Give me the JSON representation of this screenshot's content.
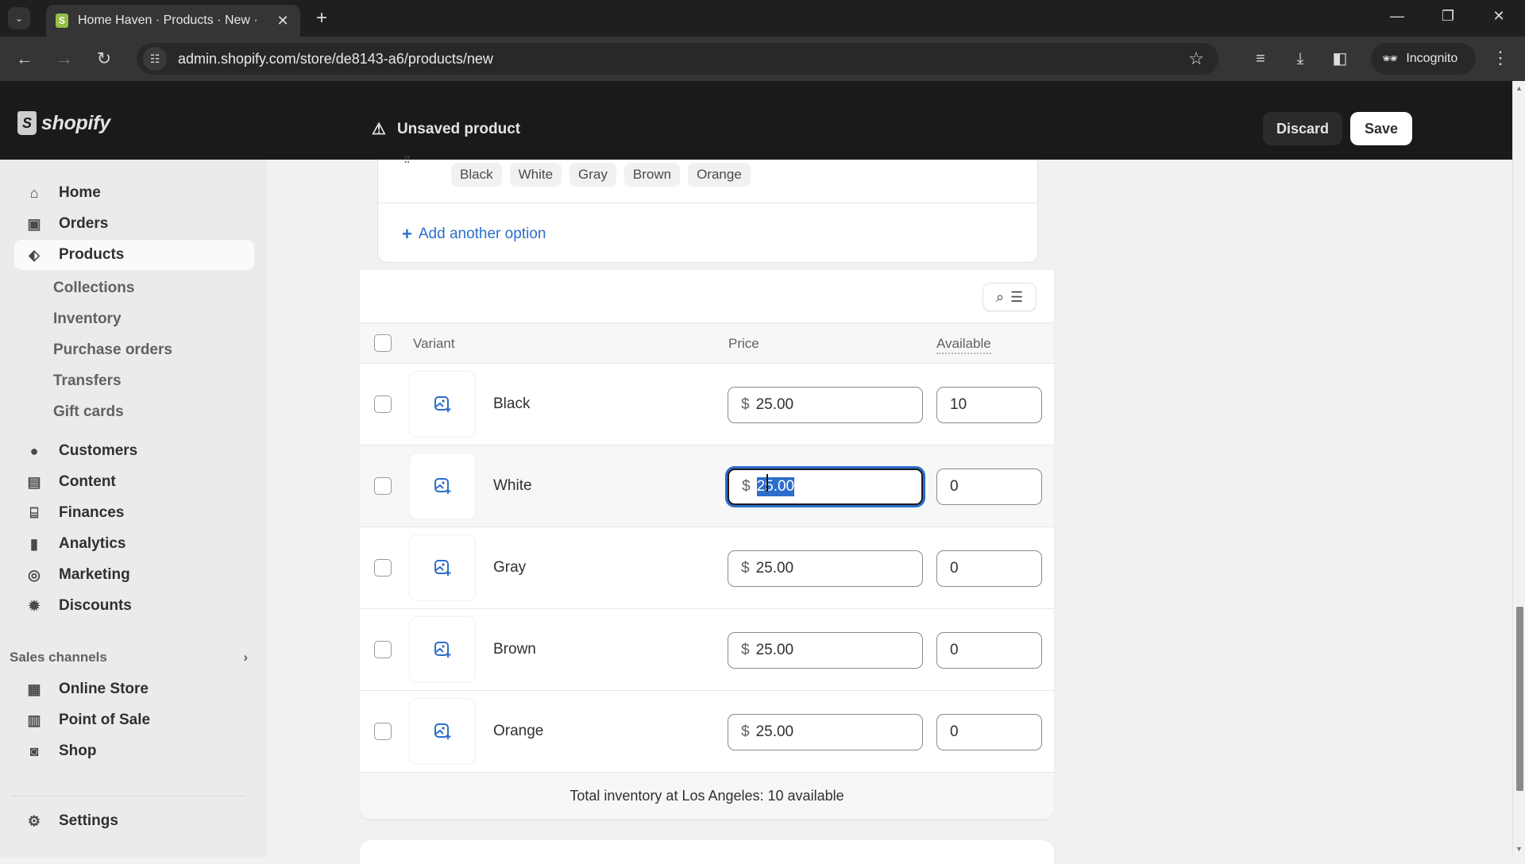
{
  "browser": {
    "tab_title": "Home Haven · Products · New ·",
    "favicon_label": "S",
    "url": "admin.shopify.com/store/de8143-a6/products/new",
    "incognito_label": "Incognito",
    "icons": {
      "tab_search": "chevron-down-icon",
      "new_tab": "plus-icon",
      "back": "arrow-left-icon",
      "forward": "arrow-right-icon",
      "reload": "reload-icon",
      "site_info": "tune-icon",
      "bookmark": "star-icon",
      "media": "playlist-icon",
      "downloads": "download-icon",
      "side_panel": "sidebar-icon",
      "menu": "kebab-icon"
    }
  },
  "header": {
    "logo_text": "shopify",
    "status_text": "Unsaved product",
    "discard_label": "Discard",
    "save_label": "Save"
  },
  "sidebar": {
    "items": [
      {
        "label": "Home",
        "icon": "home-icon"
      },
      {
        "label": "Orders",
        "icon": "inbox-icon"
      },
      {
        "label": "Products",
        "icon": "tag-icon",
        "active": true
      }
    ],
    "product_subitems": [
      "Collections",
      "Inventory",
      "Purchase orders",
      "Transfers",
      "Gift cards"
    ],
    "items2": [
      {
        "label": "Customers",
        "icon": "person-icon"
      },
      {
        "label": "Content",
        "icon": "content-icon"
      },
      {
        "label": "Finances",
        "icon": "bank-icon"
      },
      {
        "label": "Analytics",
        "icon": "bar-chart-icon"
      },
      {
        "label": "Marketing",
        "icon": "target-icon"
      },
      {
        "label": "Discounts",
        "icon": "discount-icon"
      }
    ],
    "sales_channels_label": "Sales channels",
    "channels": [
      {
        "label": "Online Store",
        "icon": "store-icon"
      },
      {
        "label": "Point of Sale",
        "icon": "pos-icon"
      },
      {
        "label": "Shop",
        "icon": "shop-icon"
      }
    ],
    "settings_label": "Settings"
  },
  "options": {
    "values": [
      "Black",
      "White",
      "Gray",
      "Brown",
      "Orange"
    ],
    "add_option_label": "Add another option"
  },
  "variants": {
    "columns": {
      "variant": "Variant",
      "price": "Price",
      "available": "Available"
    },
    "currency_symbol": "$",
    "rows": [
      {
        "name": "Black",
        "price": "25.00",
        "available": "10"
      },
      {
        "name": "White",
        "price": "25.00",
        "available": "0",
        "focused": true
      },
      {
        "name": "Gray",
        "price": "25.00",
        "available": "0"
      },
      {
        "name": "Brown",
        "price": "25.00",
        "available": "0"
      },
      {
        "name": "Orange",
        "price": "25.00",
        "available": "0"
      }
    ],
    "footer_text": "Total inventory at Los Angeles: 10 available"
  },
  "colors": {
    "accent_blue": "#2c6ecb",
    "header_bg": "#1a1a1a",
    "sidebar_bg": "#ebebeb"
  }
}
